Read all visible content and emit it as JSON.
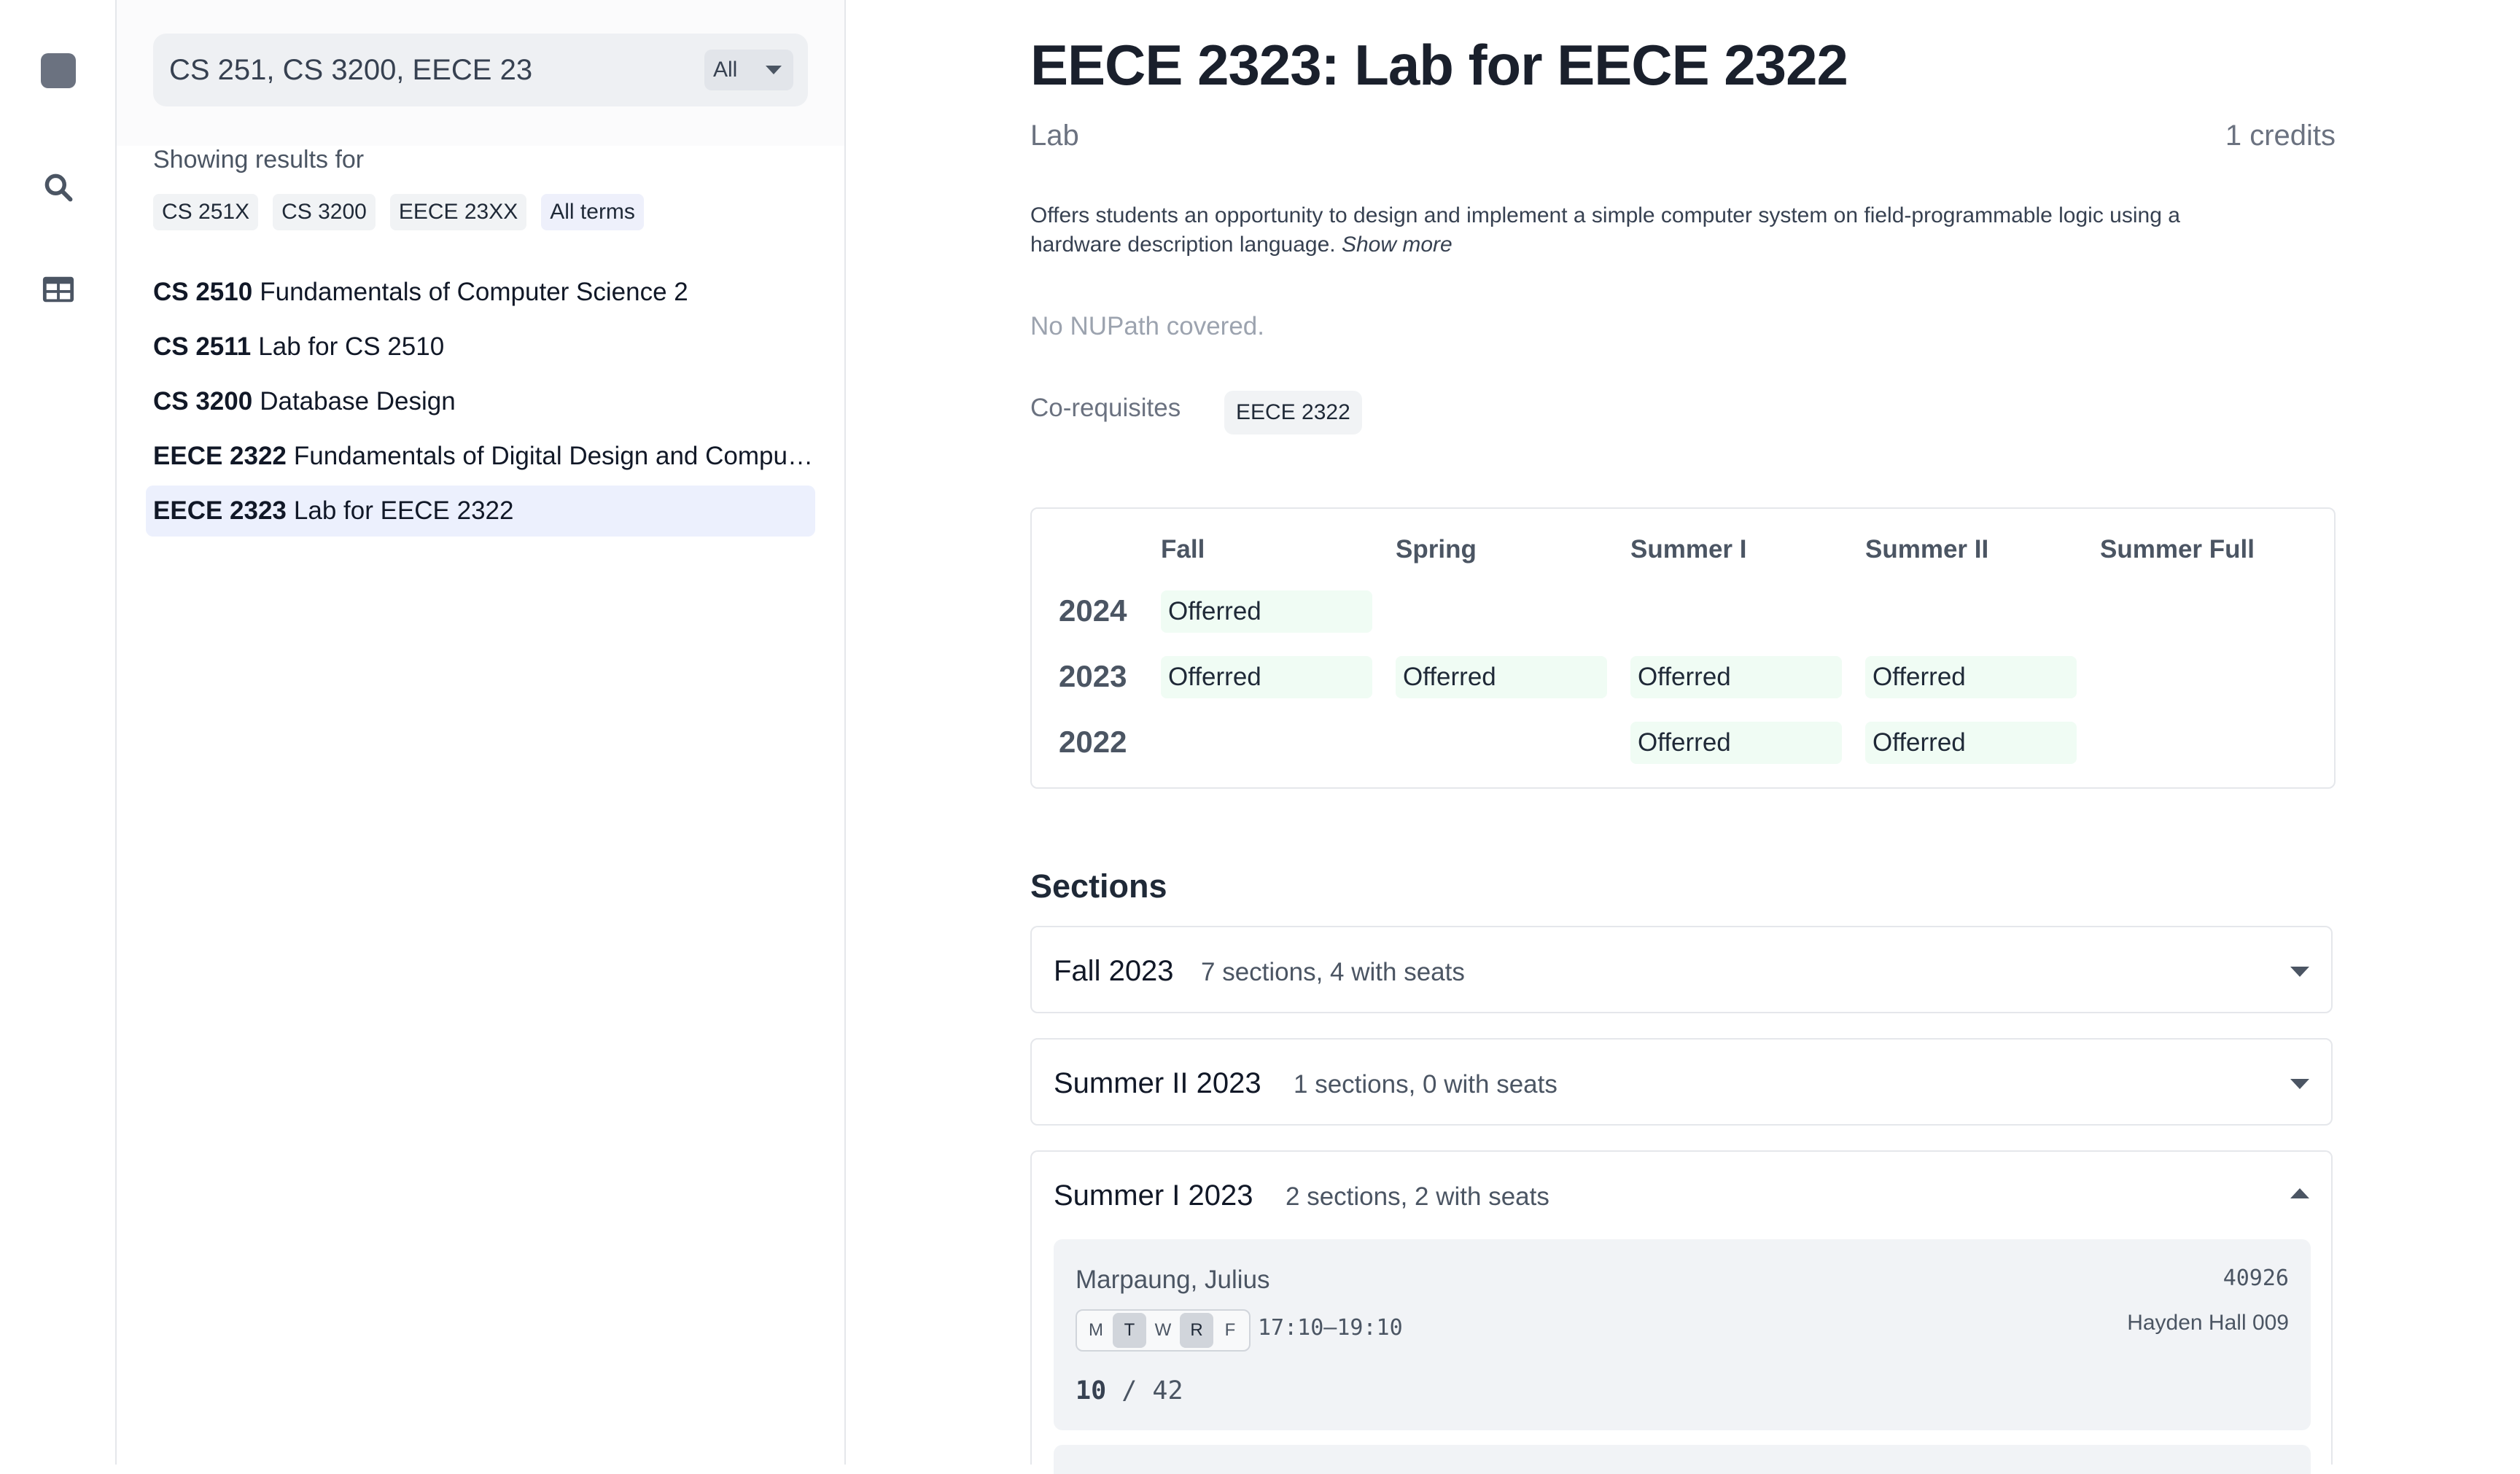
{
  "search": {
    "value": "CS 251, CS 3200, EECE 23",
    "term_filter": "All"
  },
  "filters": {
    "showing_label": "Showing results for",
    "chips": [
      "CS 251X",
      "CS 3200",
      "EECE 23XX",
      "All terms"
    ]
  },
  "results": [
    {
      "code": "CS 2510",
      "title": "Fundamentals of Computer Science 2"
    },
    {
      "code": "CS 2511",
      "title": "Lab for CS 2510"
    },
    {
      "code": "CS 3200",
      "title": "Database Design"
    },
    {
      "code": "EECE 2322",
      "title": "Fundamentals of Digital Design and Computer Organization"
    },
    {
      "code": "EECE 2323",
      "title": "Lab for EECE 2322"
    }
  ],
  "course": {
    "title": "EECE 2323: Lab for EECE 2322",
    "type": "Lab",
    "credits": "1 credits",
    "description": "Offers students an opportunity to design and implement a simple computer system on field-programmable logic using a hardware description language.",
    "show_more": "Show more",
    "nupath": "No NUPath covered.",
    "coreq_label": "Co-requisites",
    "coreq": "EECE 2322"
  },
  "offerings": {
    "terms": [
      "Fall",
      "Spring",
      "Summer I",
      "Summer II",
      "Summer Full"
    ],
    "years": [
      "2024",
      "2023",
      "2022"
    ],
    "cell_label": "Offerred"
  },
  "sections": {
    "heading": "Sections",
    "terms": [
      {
        "name": "Fall 2023",
        "summary": "7 sections, 4 with seats"
      },
      {
        "name": "Summer II 2023",
        "summary": "1 sections, 0 with seats"
      },
      {
        "name": "Summer I 2023",
        "summary": "2 sections, 2 with seats"
      }
    ],
    "open_section": {
      "professor": "Marpaung, Julius",
      "crn": "40926",
      "location": "Hayden Hall 009",
      "days": [
        "M",
        "T",
        "W",
        "R",
        "F"
      ],
      "time": "17:10–19:10",
      "seats_available": "10",
      "seats_separator": "/",
      "seats_total": "42"
    }
  }
}
